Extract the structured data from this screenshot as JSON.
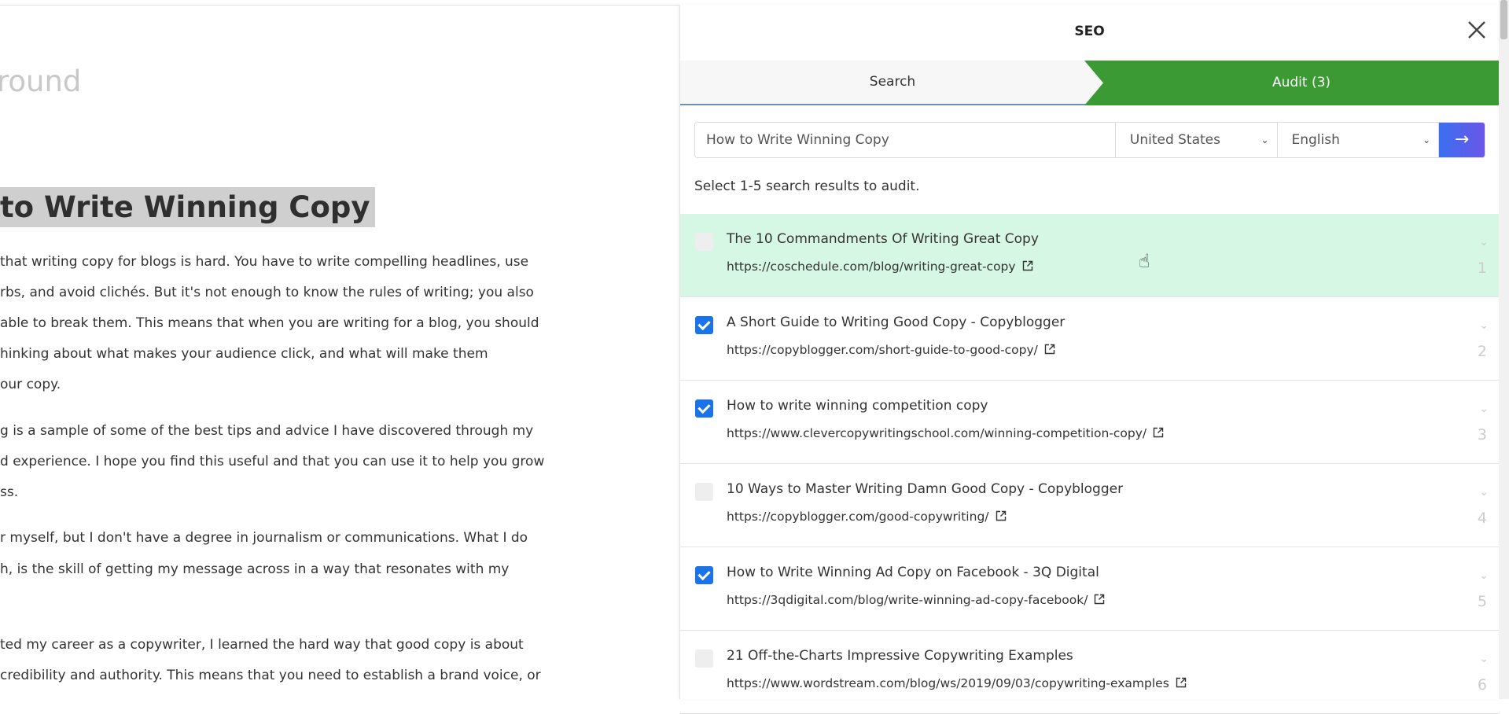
{
  "editor": {
    "faded_title": "round",
    "headline": "to Write Winning Copy",
    "lines": [
      "that writing copy for blogs is hard. You have to write compelling headlines, use",
      "rbs, and avoid clichés. But it's not enough to know the rules of writing; you also",
      "able to break them. This means that when you are writing for a blog, you should",
      "hinking about what makes your audience click, and what will make them",
      "our copy.",
      "g is a sample of some of the best tips and advice I have discovered through my",
      "d experience. I hope you find this useful and that you can use it to help you grow",
      "ss.",
      "r myself, but I don't have a degree in journalism or communications. What I do",
      "h, is the skill of getting my message across in a way that resonates with my",
      "ted my career as a copywriter, I learned the hard way that good copy is about",
      " credibility and authority. This means that you need to establish a brand voice, or"
    ]
  },
  "panel": {
    "title": "SEO",
    "close_icon": "close-icon",
    "tabs": [
      {
        "label": "Search",
        "active": false
      },
      {
        "label": "Audit (3)",
        "active": true
      }
    ],
    "accent_color": "#3c9a34",
    "search": {
      "query": "How to Write Winning Copy",
      "country": "United States",
      "language": "English",
      "submit_icon": "arrow-right-icon"
    },
    "hint": "Select 1-5 search results to audit.",
    "results": [
      {
        "title": "The 10 Commandments Of Writing Great Copy",
        "url": "https://coschedule.com/blog/writing-great-copy",
        "checked": false,
        "rank": "1"
      },
      {
        "title": "A Short Guide to Writing Good Copy - Copyblogger",
        "url": "https://copyblogger.com/short-guide-to-good-copy/",
        "checked": true,
        "rank": "2"
      },
      {
        "title": "How to write winning competition copy",
        "url": "https://www.clevercopywritingschool.com/winning-competition-copy/",
        "checked": true,
        "rank": "3"
      },
      {
        "title": "10 Ways to Master Writing Damn Good Copy - Copyblogger",
        "url": "https://copyblogger.com/good-copywriting/",
        "checked": false,
        "rank": "4"
      },
      {
        "title": "How to Write Winning Ad Copy on Facebook - 3Q Digital",
        "url": "https://3qdigital.com/blog/write-winning-ad-copy-facebook/",
        "checked": true,
        "rank": "5"
      },
      {
        "title": "21 Off-the-Charts Impressive Copywriting Examples",
        "url": "https://www.wordstream.com/blog/ws/2019/09/03/copywriting-examples",
        "checked": false,
        "rank": "6"
      }
    ]
  }
}
